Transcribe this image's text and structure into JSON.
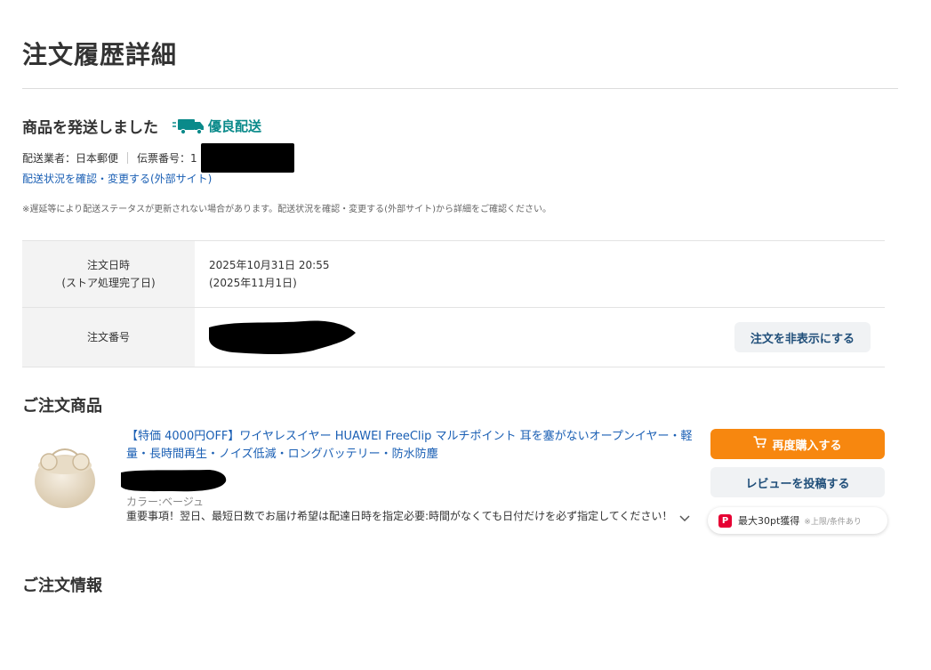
{
  "page": {
    "title": "注文履歴詳細"
  },
  "shipping": {
    "status": "商品を発送しました",
    "badge": "優良配送",
    "carrier_label": "配送業者：日本郵便",
    "tracking_label": "伝票番号：1",
    "tracking_link": "配送状況を確認・変更する(外部サイト)",
    "notice": "※遅延等により配送ステータスが更新されない場合があります。配送状況を確認・変更する(外部サイト)から詳細をご確認ください。"
  },
  "order_table": {
    "date_label_1": "注文日時",
    "date_label_2": "(ストア処理完了日)",
    "date_value": "2025年10月31日 20:55",
    "completed_value": "(2025年11月1日)",
    "number_label": "注文番号",
    "hide_button": "注文を非表示にする"
  },
  "items_section": {
    "title": "ご注文商品",
    "product_name": "【特価 4000円OFF】ワイヤレスイヤー HUAWEI FreeClip マルチポイント 耳を塞がないオープンイヤー・軽量・長時間再生・ノイズ低減・ロングバッテリー・防水防塵",
    "variant": "カラー:ベージュ",
    "important": "重要事項！翌日、最短日数でお届け希望は配達日時を指定必要:時間がなくても日付だけを必ず指定してください！",
    "rebuy_button": "再度購入する",
    "review_button": "レビューを投稿する",
    "points_logo": "P",
    "points_text": "最大30pt獲得",
    "points_note": "※上限/条件あり"
  },
  "order_info_section": {
    "title": "ご注文情報"
  },
  "icons": {
    "truck": "truck-icon",
    "cart": "cart-icon",
    "chevron": "chevron-down-icon",
    "points": "paypay-points-icon"
  },
  "colors": {
    "accent_orange": "#f7870f",
    "link_blue": "#1a5fb4",
    "premium_teal": "#0a8a8a",
    "secondary_button_bg": "#f0f2f4",
    "secondary_button_text": "#1f4e79",
    "label_bg": "#f3f3f3"
  }
}
